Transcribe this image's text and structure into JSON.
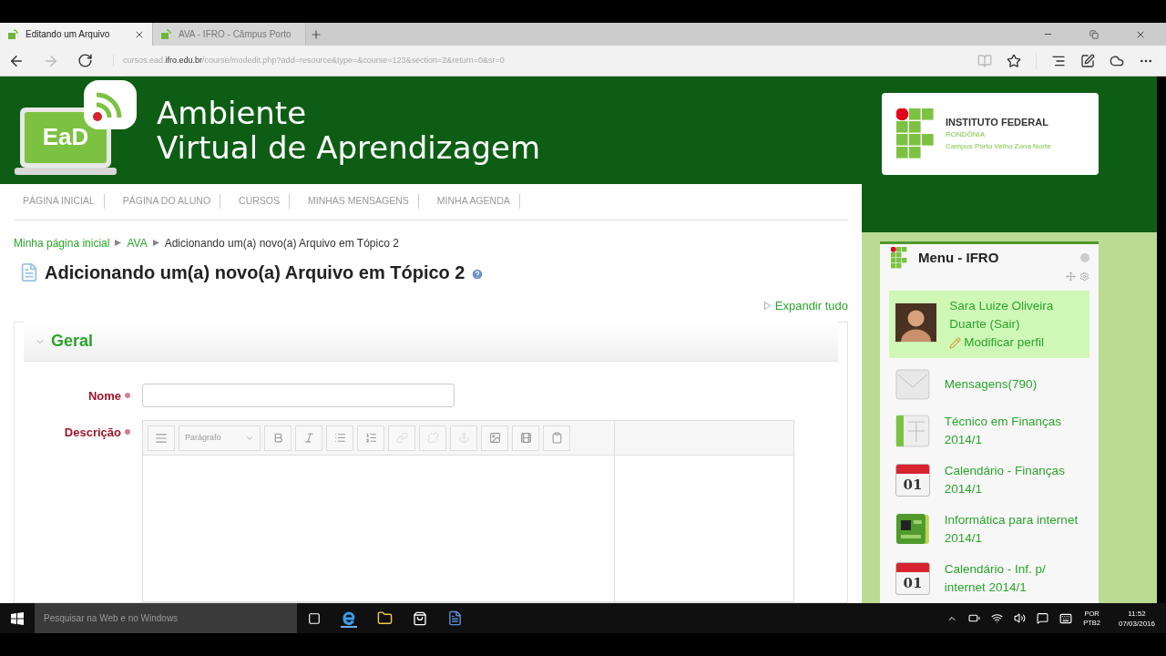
{
  "browser": {
    "tabs": [
      {
        "title": "Editando um Arquivo",
        "selected": true
      },
      {
        "title": "AVA - IFRO - Câmpus Porto",
        "selected": false
      }
    ],
    "url": {
      "prefix": "cursos.ead.",
      "domain": "ifro.edu.br",
      "path": "/course/modedit.php?add=resource&type=&course=123&section=2&return=0&sr=0"
    }
  },
  "header": {
    "logo_text": "EaD",
    "title_lines": [
      "Ambiente",
      "Virtual de Aprendizagem"
    ],
    "institution": {
      "name": "INSTITUTO FEDERAL",
      "state": "RONDÔNIA",
      "campus": "Campus Porto Velho Zona Norte"
    }
  },
  "nav": [
    "PÁGINA INICIAL",
    "PÁGINA DO ALUNO",
    "CURSOS",
    "MINHAS MENSAGENS",
    "MINHA AGENDA"
  ],
  "breadcrumb": [
    "Minha página inicial",
    "AVA",
    "Adicionando um(a) novo(a) Arquivo em Tópico 2"
  ],
  "heading": "Adicionando um(a) novo(a) Arquivo em Tópico 2",
  "expand_all": "Expandir tudo",
  "section": {
    "title": "Geral",
    "expanded": true,
    "fields": [
      {
        "label": "Nome",
        "kind": "text"
      },
      {
        "label": "Descrição",
        "kind": "editor",
        "format": "Parágrafo"
      }
    ]
  },
  "sidebar": {
    "title": "Menu - IFRO",
    "user": {
      "name": "Sara Luize Oliveira Duarte",
      "logout": "(Sair)",
      "edit_profile": "Modificar perfil"
    },
    "items": [
      {
        "kind": "mail",
        "label": "Mensagens(790)"
      },
      {
        "kind": "course",
        "label": "Técnico em Finanças 2014/1"
      },
      {
        "kind": "calendar",
        "label": "Calendário - Finanças 2014/1",
        "day": "01"
      },
      {
        "kind": "app",
        "label": "Informática para internet 2014/1"
      },
      {
        "kind": "calendar",
        "label": "Calendário - Inf. p/ internet 2014/1",
        "day": "01"
      }
    ]
  },
  "taskbar": {
    "search_placeholder": "Pesquisar na Web e no Windows",
    "language": [
      "POR",
      "PTB2"
    ],
    "time": "11:52",
    "date": "07/03/2016"
  }
}
